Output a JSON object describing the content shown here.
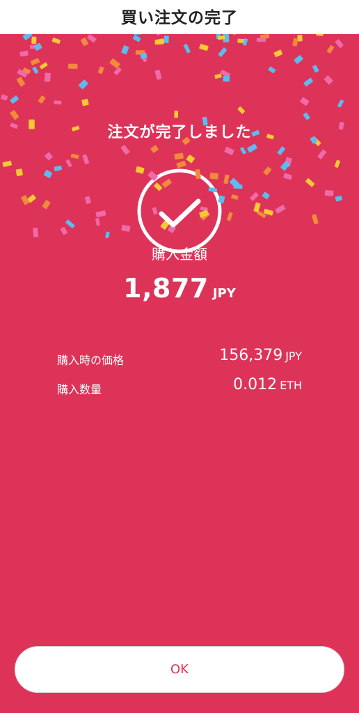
{
  "header": {
    "title": "買い注文の完了"
  },
  "result": {
    "message": "注文が完了しました",
    "icon": "check-circle-icon"
  },
  "purchase_amount": {
    "label": "購入金額",
    "value": "1,877",
    "unit": "JPY"
  },
  "details": [
    {
      "label": "購入時の価格",
      "value": "156,379",
      "unit": "JPY"
    },
    {
      "label": "購入数量",
      "value": "0.012",
      "unit": "ETH"
    }
  ],
  "actions": {
    "ok_label": "OK"
  },
  "colors": {
    "background": "#de3358",
    "text": "#ffffff",
    "header_bg": "#ffffff",
    "header_text": "#222222",
    "button_bg": "#ffffff",
    "button_text": "#e2345a",
    "confetti": [
      "#5bbcf0",
      "#f7c934",
      "#ef6aa9",
      "#f08a3c"
    ]
  }
}
